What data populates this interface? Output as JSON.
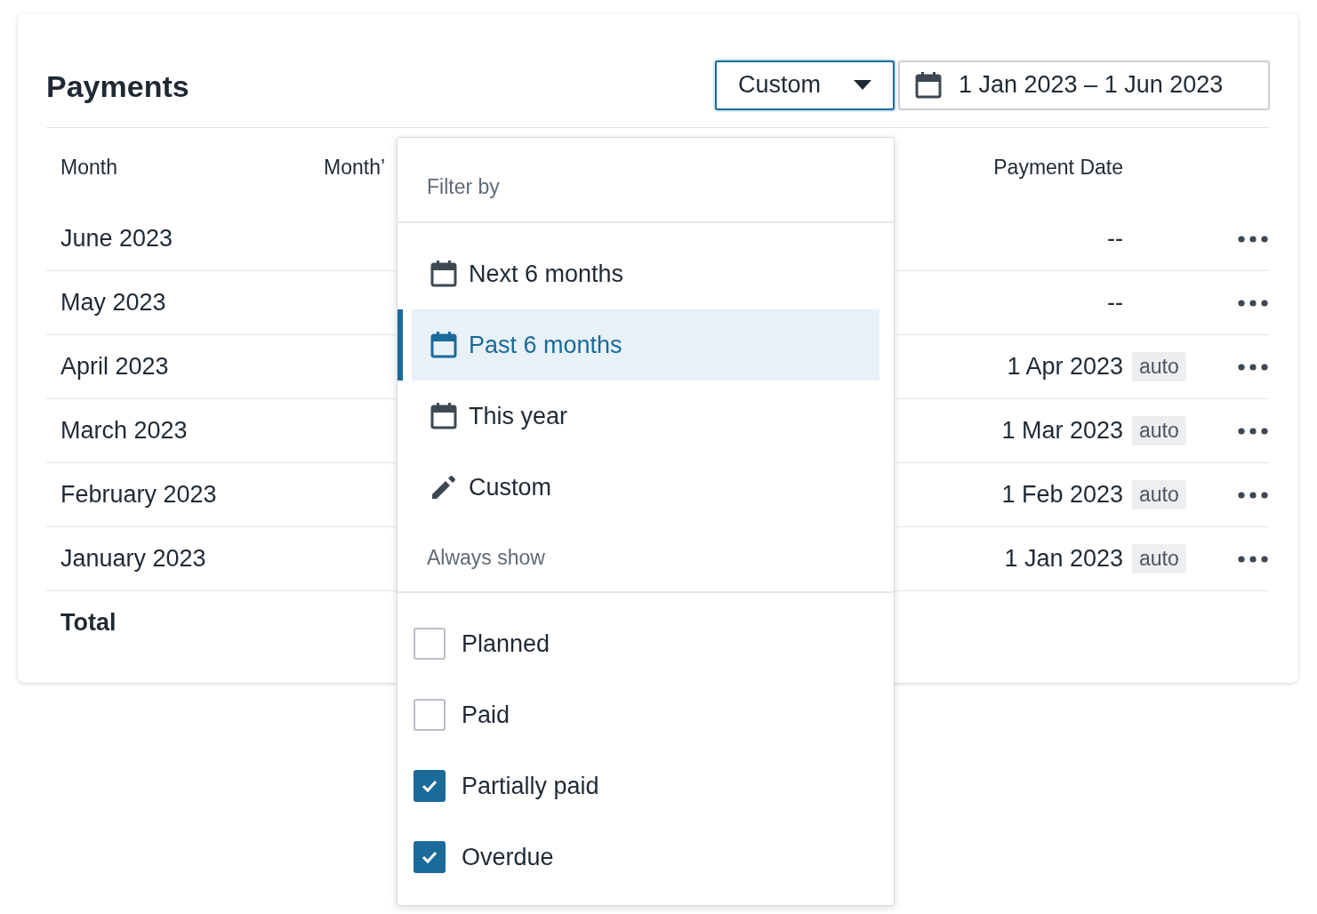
{
  "title": "Payments",
  "period_select": {
    "value": "Custom"
  },
  "date_range": {
    "value": "1 Jan 2023 – 1 Jun 2023"
  },
  "table": {
    "columns": [
      "Month",
      "Month’",
      "Payment Date"
    ],
    "rows": [
      {
        "month": "June 2023",
        "payment_date": "--"
      },
      {
        "month": "May 2023",
        "payment_date": "--"
      },
      {
        "month": "April 2023",
        "payment_date": "1 Apr 2023",
        "badge": "auto"
      },
      {
        "month": "March 2023",
        "payment_date": "1 Mar 2023",
        "badge": "auto"
      },
      {
        "month": "February 2023",
        "payment_date": "1 Feb 2023",
        "badge": "auto"
      },
      {
        "month": "January 2023",
        "payment_date": "1 Jan 2023",
        "badge": "auto"
      }
    ],
    "total_label": "Total"
  },
  "dropdown": {
    "filter_heading": "Filter by",
    "filters": [
      {
        "kind": "calendar",
        "label": "Next 6 months",
        "selected": false
      },
      {
        "kind": "calendar",
        "label": "Past 6 months",
        "selected": true
      },
      {
        "kind": "calendar",
        "label": "This year",
        "selected": false
      },
      {
        "kind": "edit",
        "label": "Custom",
        "selected": false
      }
    ],
    "show_heading": "Always show",
    "statuses": [
      {
        "label": "Planned",
        "checked": false
      },
      {
        "label": "Paid",
        "checked": false
      },
      {
        "label": "Partially paid",
        "checked": true
      },
      {
        "label": "Overdue",
        "checked": true
      }
    ]
  }
}
